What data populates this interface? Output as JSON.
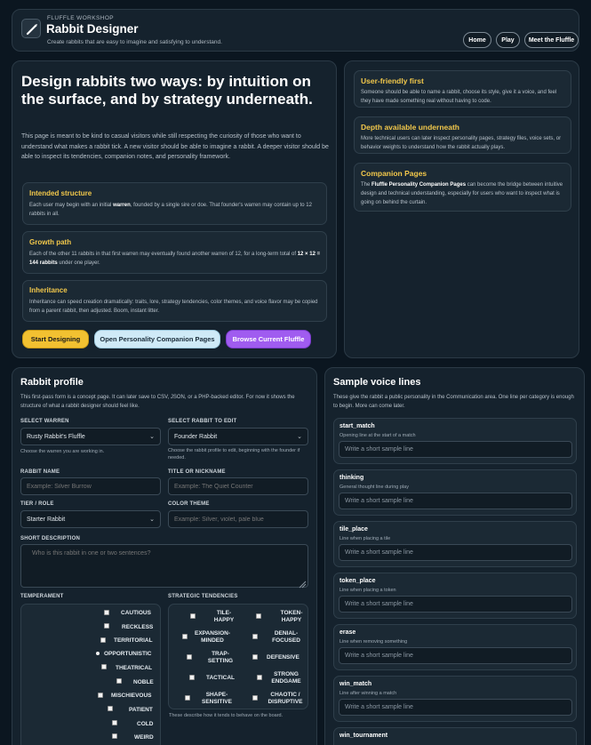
{
  "header": {
    "eyebrow": "FLUFFLE WORKSHOP",
    "title": "Rabbit Designer",
    "subtitle": "Create rabbits that are easy to imagine and satisfying to understand.",
    "nav": [
      "Home",
      "Play",
      "Meet the Fluffle"
    ]
  },
  "hero": {
    "heading": "Design rabbits two ways: by intuition on the surface, and by strategy underneath.",
    "intro": "This page is meant to be kind to casual visitors while still respecting the curiosity of those who want to understand what makes a rabbit tick. A new visitor should be able to imagine a rabbit. A deeper visitor should be able to inspect its tendencies, companion notes, and personality framework.",
    "cards": [
      {
        "title": "Intended structure",
        "before": "Each user may begin with an initial ",
        "bold": "warren",
        "after": ", founded by a single sire or doe. That founder's warren may contain up to 12 rabbits in all."
      },
      {
        "title": "Growth path",
        "before": "Each of the other 11 rabbits in that first warren may eventually found another warren of 12, for a long-term total of ",
        "bold": "12 × 12 = 144 rabbits",
        "after": " under one player."
      },
      {
        "title": "Inheritance",
        "before": "Inheritance can speed creation dramatically: traits, lore, strategy tendencies, color themes, and voice flavor may be copied from a parent rabbit, then adjusted. Boom, instant litter.",
        "bold": "",
        "after": ""
      }
    ],
    "buttons": [
      "Start Designing",
      "Open Personality Companion Pages",
      "Browse Current Fluffle"
    ]
  },
  "side": {
    "cards": [
      {
        "title": "User-friendly first",
        "before": "Someone should be able to name a rabbit, choose its style, give it a voice, and feel they have made something real without having to code.",
        "bold": "",
        "after": ""
      },
      {
        "title": "Depth available underneath",
        "before": "More technical users can later inspect personality pages, strategy files, voice sets, or behavior weights to understand how the rabbit actually plays.",
        "bold": "",
        "after": ""
      },
      {
        "title": "Companion Pages",
        "before": "The ",
        "bold": "Fluffle Personality Companion Pages",
        "after": " can become the bridge between intuitive design and technical understanding, especially for users who want to inspect what is going on behind the curtain."
      }
    ]
  },
  "profile": {
    "title": "Rabbit profile",
    "intro": "This first-pass form is a concept page. It can later save to CSV, JSON, or a PHP-backed editor. For now it shows the structure of what a rabbit designer should feel like.",
    "select_warren": {
      "label": "SELECT WARREN",
      "value": "Rusty Rabbit's Fluffle",
      "hint": "Choose the warren you are working in."
    },
    "select_rabbit": {
      "label": "SELECT RABBIT TO EDIT",
      "value": "Founder Rabbit",
      "hint": "Choose the rabbit profile to edit, beginning with the founder if needed."
    },
    "rabbit_name": {
      "label": "RABBIT NAME",
      "placeholder": "Example: Silver Burrow"
    },
    "title_nick": {
      "label": "TITLE OR NICKNAME",
      "placeholder": "Example: The Quiet Counter"
    },
    "tier": {
      "label": "TIER / ROLE",
      "value": "Starter Rabbit"
    },
    "color_theme": {
      "label": "COLOR THEME",
      "placeholder": "Example: Silver, violet, pale blue"
    },
    "short_desc": {
      "label": "SHORT DESCRIPTION",
      "placeholder": "Who is this rabbit in one or two sentences?"
    },
    "temperament": {
      "label": "TEMPERAMENT",
      "items": [
        "CAUTIOUS",
        "RECKLESS",
        "TERRITORIAL",
        "OPPORTUNISTIC",
        "THEATRICAL",
        "NOBLE",
        "MISCHIEVOUS",
        "PATIENT",
        "COLD",
        "WEIRD"
      ]
    },
    "strategic": {
      "label": "STRATEGIC TENDENCIES",
      "items": [
        [
          "TILE-",
          "HAPPY"
        ],
        [
          "TOKEN-",
          "HAPPY"
        ],
        [
          "EXPANSION-",
          "MINDED"
        ],
        [
          "DENIAL-",
          "FOCUSED"
        ],
        [
          "TRAP-",
          "SETTING"
        ],
        [
          "DEFENSIVE"
        ],
        [
          "TACTICAL"
        ],
        [
          "STRONG",
          "ENDGAME"
        ],
        [
          "SHAPE-",
          "SENSITIVE"
        ],
        [
          "CHAOTIC /",
          "DISRUPTIVE"
        ]
      ],
      "hint": "These describe how it tends to behave on the board."
    }
  },
  "voice": {
    "title": "Sample voice lines",
    "intro": "These give the rabbit a public personality in the Communication area. One line per category is enough to begin. More can come later.",
    "placeholder": "Write a short sample line",
    "lines": [
      {
        "name": "start_match",
        "desc": "Opening line at the start of a match"
      },
      {
        "name": "thinking",
        "desc": "General thought line during play"
      },
      {
        "name": "tile_place",
        "desc": "Line when placing a tile"
      },
      {
        "name": "token_place",
        "desc": "Line when placing a token"
      },
      {
        "name": "erase",
        "desc": "Line when removing something"
      },
      {
        "name": "win_match",
        "desc": "Line after winning a match"
      },
      {
        "name": "win_tournament",
        "desc": ""
      }
    ]
  },
  "colors": {
    "accent": "#f2c84b",
    "bg": "#0b1620",
    "panel": "#15222d",
    "btn_gold": "#f2c131",
    "btn_blue": "#cfeaf7",
    "btn_purple": "#a05cf0"
  }
}
